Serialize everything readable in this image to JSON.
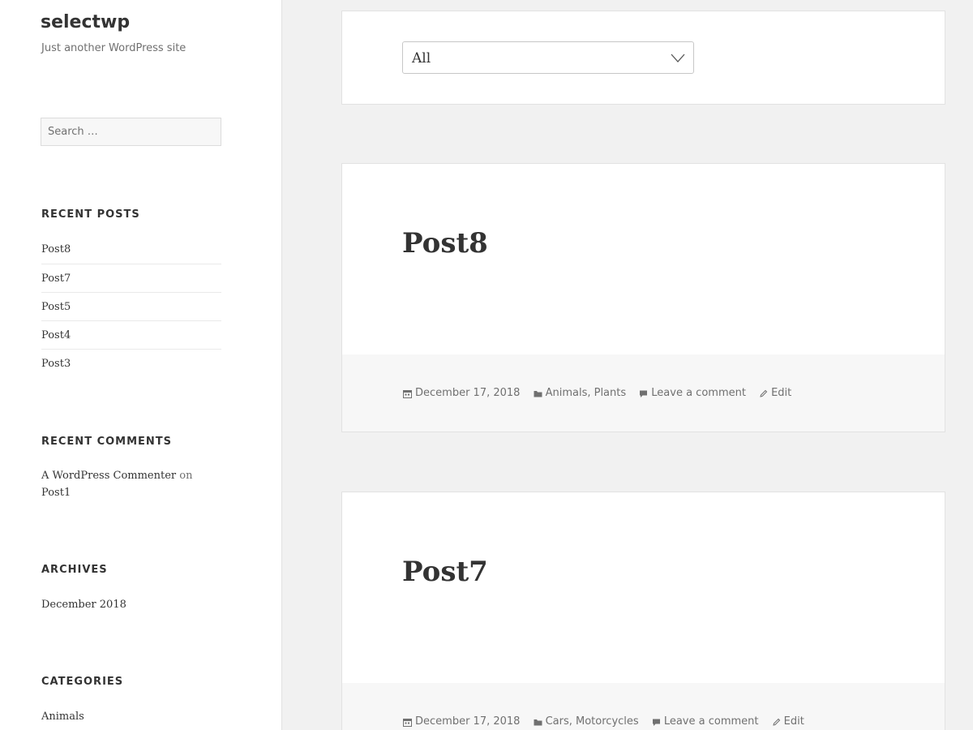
{
  "site": {
    "title": "selectwp",
    "description": "Just another WordPress site"
  },
  "search": {
    "placeholder": "Search …"
  },
  "recent_posts": {
    "title": "RECENT POSTS",
    "items": [
      "Post8",
      "Post7",
      "Post5",
      "Post4",
      "Post3"
    ]
  },
  "recent_comments": {
    "title": "RECENT COMMENTS",
    "author": "A WordPress Commenter",
    "on_text": "on",
    "post": "Post1"
  },
  "archives": {
    "title": "ARCHIVES",
    "items": [
      "December 2018"
    ]
  },
  "categories": {
    "title": "CATEGORIES",
    "items": [
      "Animals"
    ]
  },
  "filter": {
    "selected": "All"
  },
  "posts": [
    {
      "title": "Post8",
      "date": "December 17, 2018",
      "categories": [
        "Animals",
        "Plants"
      ],
      "comment_link": "Leave a comment",
      "edit_link": "Edit"
    },
    {
      "title": "Post7",
      "date": "December 17, 2018",
      "categories": [
        "Cars",
        "Motorcycles"
      ],
      "comment_link": "Leave a comment",
      "edit_link": "Edit"
    }
  ],
  "colors": {
    "background": "#f1f1f1",
    "card": "#ffffff",
    "footer": "#f7f7f7",
    "text": "#333333",
    "muted": "#707070"
  },
  "icons": [
    "calendar-icon",
    "folder-icon",
    "comment-icon",
    "pencil-icon",
    "chevron-down-icon"
  ]
}
